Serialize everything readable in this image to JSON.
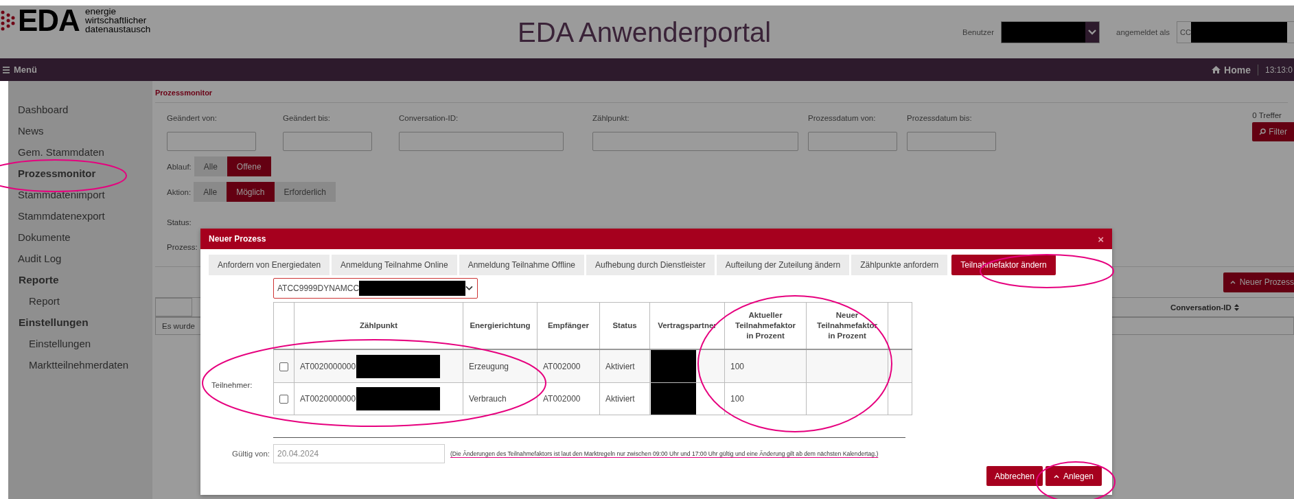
{
  "header": {
    "logo_text": "EDA",
    "logo_tagline": [
      "energie",
      "wirtschaftlicher",
      "datenaustausch"
    ],
    "title": "EDA Anwenderportal",
    "user_label": "Benutzer",
    "logged_in_label": "angemeldet als",
    "logged_in_value": "CC"
  },
  "navbar": {
    "menu": "Menü",
    "home": "Home",
    "time": "13:13:0"
  },
  "sidebar": {
    "items": [
      {
        "label": "Dashboard",
        "kind": "link",
        "selected": false
      },
      {
        "label": "News",
        "kind": "link",
        "selected": false
      },
      {
        "label": "Gem. Stammdaten",
        "kind": "link",
        "selected": false
      },
      {
        "label": "Prozessmonitor",
        "kind": "link",
        "selected": true
      },
      {
        "label": "Stammdatenimport",
        "kind": "link",
        "selected": false
      },
      {
        "label": "Stammdatenexport",
        "kind": "link",
        "selected": false
      },
      {
        "label": "Dokumente",
        "kind": "link",
        "selected": false
      },
      {
        "label": "Audit Log",
        "kind": "link",
        "selected": false
      },
      {
        "label": "Reporte",
        "kind": "heading",
        "children": [
          {
            "label": "Report",
            "selected": false
          }
        ]
      },
      {
        "label": "Einstellungen",
        "kind": "heading",
        "children": [
          {
            "label": "Einstellungen",
            "selected": false
          },
          {
            "label": "Marktteilnehmerdaten",
            "selected": false
          }
        ]
      }
    ]
  },
  "breadcrumb": "Prozessmonitor",
  "filters": [
    {
      "label": "Geändert von:"
    },
    {
      "label": "Geändert bis:"
    },
    {
      "label": "Conversation-ID:"
    },
    {
      "label": "Zählpunkt:"
    },
    {
      "label": "Prozessdatum von:"
    },
    {
      "label": "Prozessdatum bis:"
    }
  ],
  "hits": "0 Treffer",
  "filter_button": "Filter",
  "toggles": [
    {
      "label": "Ablauf:",
      "options": [
        {
          "label": "Alle",
          "selected": false
        },
        {
          "label": "Offene",
          "selected": true
        }
      ]
    },
    {
      "label": "Aktion:",
      "options": [
        {
          "label": "Alle",
          "selected": false
        },
        {
          "label": "Möglich",
          "selected": true
        },
        {
          "label": "Erforderlich",
          "selected": false
        }
      ]
    }
  ],
  "status_label": "Status:",
  "prozess_label": "Prozess:",
  "new_process_button": "Neuer Prozess",
  "results_table": {
    "columns": [
      {
        "label": "Conversation-ID"
      }
    ],
    "empty_message": "Es wurde"
  },
  "dialog": {
    "title": "Neuer Prozess",
    "close": "×",
    "tabs": [
      {
        "label": "Anfordern von Energiedaten",
        "selected": false
      },
      {
        "label": "Anmeldung Teilnahme Online",
        "selected": false
      },
      {
        "label": "Anmeldung Teilnahme Offline",
        "selected": false
      },
      {
        "label": "Aufhebung durch Dienstleister",
        "selected": false
      },
      {
        "label": "Aufteilung der Zuteilung ändern",
        "selected": false
      },
      {
        "label": "Zählpunkte anfordern",
        "selected": false
      },
      {
        "label": "Teilnahmefaktor ändern",
        "selected": true
      }
    ],
    "select_value": "ATCC9999DYNAMCC",
    "participants_label": "Teilnehmer:",
    "columns": [
      "Zählpunkt",
      "Energierichtung",
      "Empfänger",
      "Status",
      "Vertragspartner",
      "Aktueller Teilnahmefaktor in Prozent",
      "Neuer Teilnahmefaktor in Prozent"
    ],
    "rows": [
      {
        "checked": false,
        "metering_point": "AT0020000000",
        "direction": "Erzeugung",
        "recipient": "AT002000",
        "status": "Aktiviert",
        "current_factor": "100"
      },
      {
        "checked": false,
        "metering_point": "AT0020000000",
        "direction": "Verbrauch",
        "recipient": "AT002000",
        "status": "Aktiviert",
        "current_factor": "100"
      }
    ],
    "valid_from": {
      "label": "Gültig von:",
      "value": "20.04.2024"
    },
    "hint": "(Die Änderungen des Teilnahmefaktors ist laut den Marktregeln nur zwischen 09:00 Uhr und 17:00 Uhr gültig und eine Änderung gilt ab dem nächsten Kalendertag.)",
    "cancel_button": "Abbrechen",
    "create_button": "Anlegen"
  }
}
